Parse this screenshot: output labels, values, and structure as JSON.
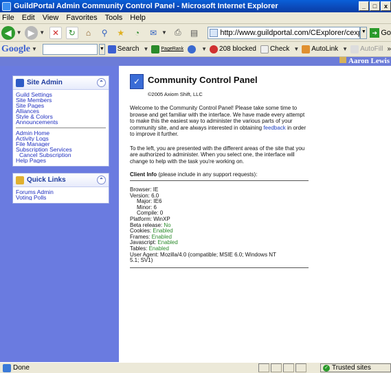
{
  "window": {
    "title": "GuildPortal Admin Community Control Panel - Microsoft Internet Explorer",
    "min_glyph": "_",
    "max_glyph": "□",
    "close_glyph": "x"
  },
  "menu": [
    "File",
    "Edit",
    "View",
    "Favorites",
    "Tools",
    "Help"
  ],
  "toolbar": {
    "address_url": "http://www.guildportal.com/CExplorer/cexpFram",
    "go_label": "Go"
  },
  "google_bar": {
    "logo": "Google",
    "search_label": "Search",
    "pagerank_label": "PageRank",
    "blocked_label": "208 blocked",
    "check_label": "Check",
    "autolink_label": "AutoLink",
    "autofill_label": "AutoFill",
    "more_glyph": "»"
  },
  "user": {
    "name": "Aaron Lewis"
  },
  "site_admin": {
    "title": "Site Admin",
    "collapse_glyph": "⌃",
    "links_top": [
      "Guild Settings",
      "Site Members",
      "Site Pages",
      "Alliances",
      "Style & Colors",
      "Announcements"
    ],
    "links_bottom": [
      "Admin Home",
      "Activity Logs",
      "File Manager",
      "Subscription Services",
      "Cancel Subscription",
      "Help Pages"
    ]
  },
  "quick_links": {
    "title": "Quick Links",
    "collapse_glyph": "⌃",
    "links": [
      "Forums Admin",
      "Voting Polls"
    ]
  },
  "main": {
    "title": "Community Control Panel",
    "copyright": "©2005 Axiom Shift, LLC",
    "para1_a": "Welcome to the Community Control Panel!  Please take some time to browse and get familiar with the interface. We have made every attempt to make this the easiest way to administer the various parts of your community site, and are always interested in obtaining ",
    "para1_link": "feedback",
    "para1_b": " in order to improve it further.",
    "para2": "To the left, you are presented with the different areas of the site that you are authorized to administer.  When you select one, the interface will change to help with the task you're working on.",
    "client_info_label": "Client Info",
    "client_info_note": " (please include in any support requests):",
    "browser": "Browser: IE",
    "version": "Version: 6.0",
    "major": "Major: IE6",
    "minor": "Minor: 6",
    "compile": "Compile: 0",
    "platform": "Platform: WinXP",
    "beta_label": "Beta release: ",
    "beta_value": "No",
    "cookies_label": "Cookies: ",
    "cookies_value": "Enabled",
    "frames_label": "Frames: ",
    "frames_value": "Enabled",
    "javascript_label": "Javascript: ",
    "javascript_value": "Enabled",
    "tables_label": "Tables: ",
    "tables_value": "Enabled",
    "user_agent_1": "User Agent: Mozilla/4.0 (compatible; MSIE 6.0; Windows NT",
    "user_agent_2": "5.1; SV1)"
  },
  "status": {
    "text": "Done",
    "zone": "Trusted sites"
  }
}
